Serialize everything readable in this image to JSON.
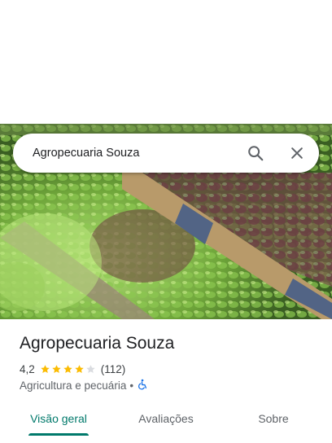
{
  "search": {
    "query": "Agropecuaria Souza"
  },
  "place": {
    "name": "Agropecuaria Souza",
    "rating": "4,2",
    "rating_value": 4.2,
    "rating_max": 5,
    "review_count": "(112)",
    "category": "Agricultura e pecuária",
    "separator": "•"
  },
  "tabs": [
    {
      "label": "Visão geral",
      "active": true
    },
    {
      "label": "Avaliações",
      "active": false
    },
    {
      "label": "Sobre",
      "active": false
    }
  ],
  "colors": {
    "accent": "#00796b",
    "star": "#fbbc04",
    "star_empty": "#dadce0",
    "accessibility": "#1a73e8"
  },
  "icons": {
    "search": "search-icon",
    "close": "close-icon",
    "star": "star-icon",
    "accessibility": "wheelchair-icon"
  }
}
